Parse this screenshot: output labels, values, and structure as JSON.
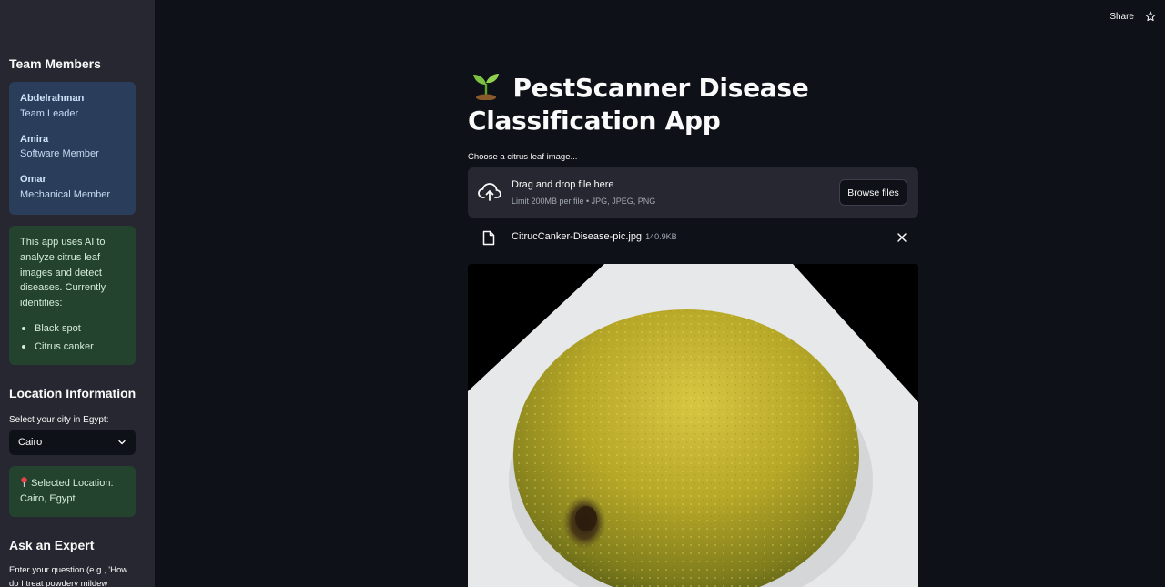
{
  "topbar": {
    "share_label": "Share"
  },
  "sidebar": {
    "team_heading": "Team Members",
    "members": [
      {
        "name": "Abdelrahman",
        "role": "Team Leader"
      },
      {
        "name": "Amira",
        "role": "Software Member"
      },
      {
        "name": "Omar",
        "role": "Mechanical Member"
      }
    ],
    "info_text": "This app uses AI to analyze citrus leaf images and detect diseases. Currently identifies:",
    "diseases": [
      "Black spot",
      "Citrus canker"
    ],
    "location_heading": "Location Information",
    "city_label": "Select your city in Egypt:",
    "city_selected": "Cairo",
    "selected_location_text": "Selected Location: Cairo, Egypt",
    "ask_heading": "Ask an Expert",
    "question_label": "Enter your question (e.g., 'How do I treat powdery mildew"
  },
  "main": {
    "title": "PestScanner Disease Classification App",
    "uploader_label": "Choose a citrus leaf image...",
    "dropzone_title": "Drag and drop file here",
    "dropzone_limit": "Limit 200MB per file • JPG, JPEG, PNG",
    "browse_label": "Browse files",
    "file_name": "CitrucCanker-Disease-pic.jpg",
    "file_size": "140.9KB"
  },
  "colors": {
    "background": "#0e1117",
    "sidebar": "#262730",
    "info_blue": "#2a3e5c",
    "success_green": "#24432f",
    "accent_red": "#e8424b"
  },
  "icons": [
    "star-icon",
    "sprout-icon",
    "cloud-upload-icon",
    "file-icon",
    "close-icon",
    "chevron-down-icon",
    "pin-icon"
  ]
}
